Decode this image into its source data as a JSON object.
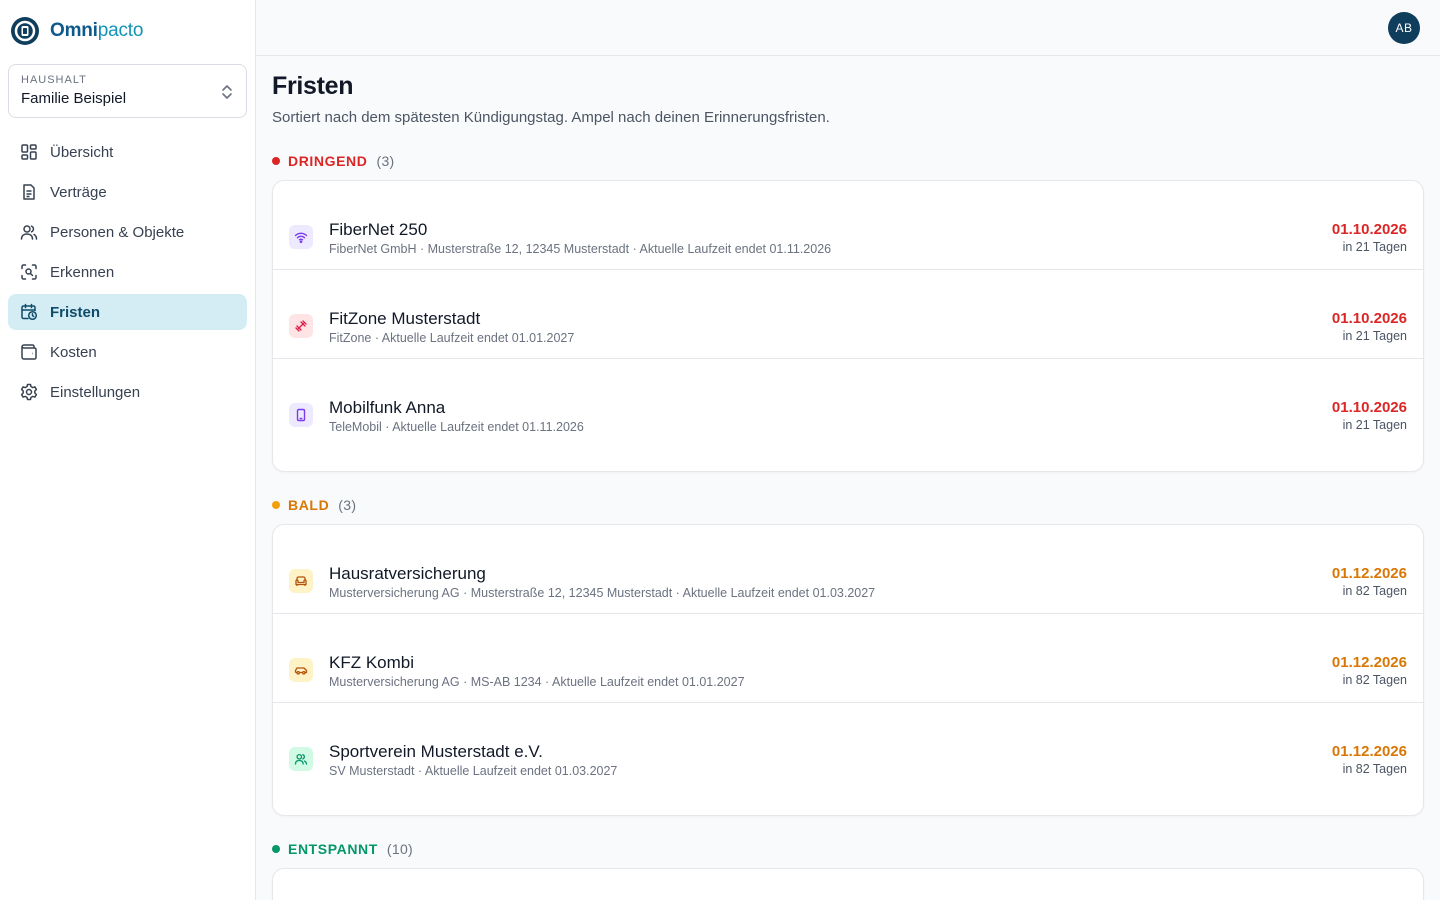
{
  "app": {
    "name_part1": "Omni",
    "name_part2": "pacto"
  },
  "household": {
    "caption": "HAUSHALT",
    "value": "Familie Beispiel"
  },
  "nav": [
    {
      "label": "Übersicht",
      "icon": "dashboard-icon"
    },
    {
      "label": "Verträge",
      "icon": "document-icon"
    },
    {
      "label": "Personen & Objekte",
      "icon": "users-icon"
    },
    {
      "label": "Erkennen",
      "icon": "scan-icon"
    },
    {
      "label": "Fristen",
      "icon": "calendar-clock-icon",
      "active": true
    },
    {
      "label": "Kosten",
      "icon": "wallet-icon"
    },
    {
      "label": "Einstellungen",
      "icon": "gear-icon"
    }
  ],
  "user": {
    "initials": "AB"
  },
  "page": {
    "title": "Fristen",
    "subtitle": "Sortiert nach dem spätesten Kündigungstag. Ampel nach deinen Erinnerungsfristen."
  },
  "colors": {
    "urgent": "#dc2626",
    "soon": "#d97706",
    "relaxed": "#059669"
  },
  "sections": [
    {
      "label": "DRINGEND",
      "count": "(3)",
      "items": [
        {
          "name": "FiberNet 250",
          "meta": "FiberNet GmbH · Musterstraße 12, 12345 Musterstadt · Aktuelle Laufzeit endet 01.11.2026",
          "date": "01.10.2026",
          "days": "in 21 Tagen",
          "icon": "wifi-icon"
        },
        {
          "name": "FitZone Musterstadt",
          "meta": "FitZone · Aktuelle Laufzeit endet 01.01.2027",
          "date": "01.10.2026",
          "days": "in 21 Tagen",
          "icon": "dumbbell-icon"
        },
        {
          "name": "Mobilfunk Anna",
          "meta": "TeleMobil · Aktuelle Laufzeit endet 01.11.2026",
          "date": "01.10.2026",
          "days": "in 21 Tagen",
          "icon": "smartphone-icon"
        }
      ]
    },
    {
      "label": "BALD",
      "count": "(3)",
      "items": [
        {
          "name": "Hausratversicherung",
          "meta": "Musterversicherung AG · Musterstraße 12, 12345 Musterstadt · Aktuelle Laufzeit endet 01.03.2027",
          "date": "01.12.2026",
          "days": "in 82 Tagen",
          "icon": "sofa-icon"
        },
        {
          "name": "KFZ Kombi",
          "meta": "Musterversicherung AG · MS-AB 1234 · Aktuelle Laufzeit endet 01.01.2027",
          "date": "01.12.2026",
          "days": "in 82 Tagen",
          "icon": "car-icon"
        },
        {
          "name": "Sportverein Musterstadt e.V.",
          "meta": "SV Musterstadt · Aktuelle Laufzeit endet 01.03.2027",
          "date": "01.12.2026",
          "days": "in 82 Tagen",
          "icon": "users-icon"
        }
      ]
    },
    {
      "label": "ENTSPANNT",
      "count": "(10)",
      "items": []
    }
  ]
}
